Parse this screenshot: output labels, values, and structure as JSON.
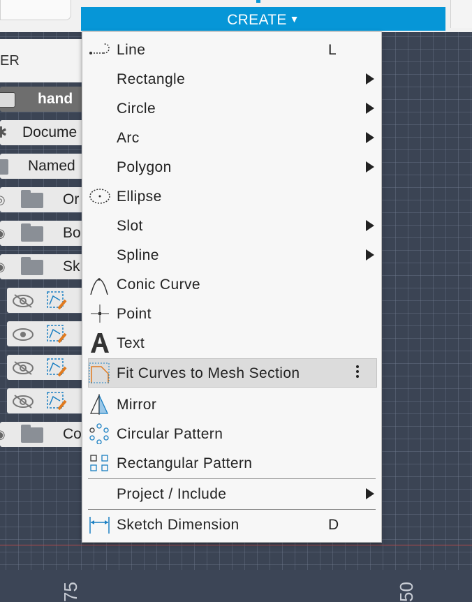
{
  "toolbar": {
    "create_label": "CREATE",
    "accent": "#0696d7"
  },
  "browser": {
    "header_text": "ER",
    "rows": [
      {
        "label": "hand"
      },
      {
        "label": "Docume"
      },
      {
        "label": "Named"
      },
      {
        "label": "Or"
      },
      {
        "label": "Bo"
      },
      {
        "label": "Sk"
      },
      {
        "label": "Co"
      }
    ]
  },
  "canvas": {
    "labels": [
      "75",
      "50"
    ]
  },
  "menu": {
    "items": [
      {
        "label": "Line",
        "shortcut": "L",
        "icon": "line-icon"
      },
      {
        "label": "Rectangle",
        "submenu": true
      },
      {
        "label": "Circle",
        "submenu": true
      },
      {
        "label": "Arc",
        "submenu": true
      },
      {
        "label": "Polygon",
        "submenu": true
      },
      {
        "label": "Ellipse",
        "icon": "ellipse-icon"
      },
      {
        "label": "Slot",
        "submenu": true
      },
      {
        "label": "Spline",
        "submenu": true
      },
      {
        "label": "Conic Curve",
        "icon": "conic-curve-icon"
      },
      {
        "label": "Point",
        "icon": "point-icon"
      },
      {
        "label": "Text",
        "icon": "text-icon"
      },
      {
        "label": "Fit Curves to Mesh Section",
        "icon": "fit-curves-icon",
        "highlighted": true
      },
      {
        "label": "Mirror",
        "icon": "mirror-icon"
      },
      {
        "label": "Circular Pattern",
        "icon": "circular-pattern-icon"
      },
      {
        "label": "Rectangular Pattern",
        "icon": "rectangular-pattern-icon"
      },
      {
        "label": "Project / Include",
        "submenu": true
      },
      {
        "label": "Sketch Dimension",
        "shortcut": "D",
        "icon": "sketch-dimension-icon"
      }
    ]
  }
}
